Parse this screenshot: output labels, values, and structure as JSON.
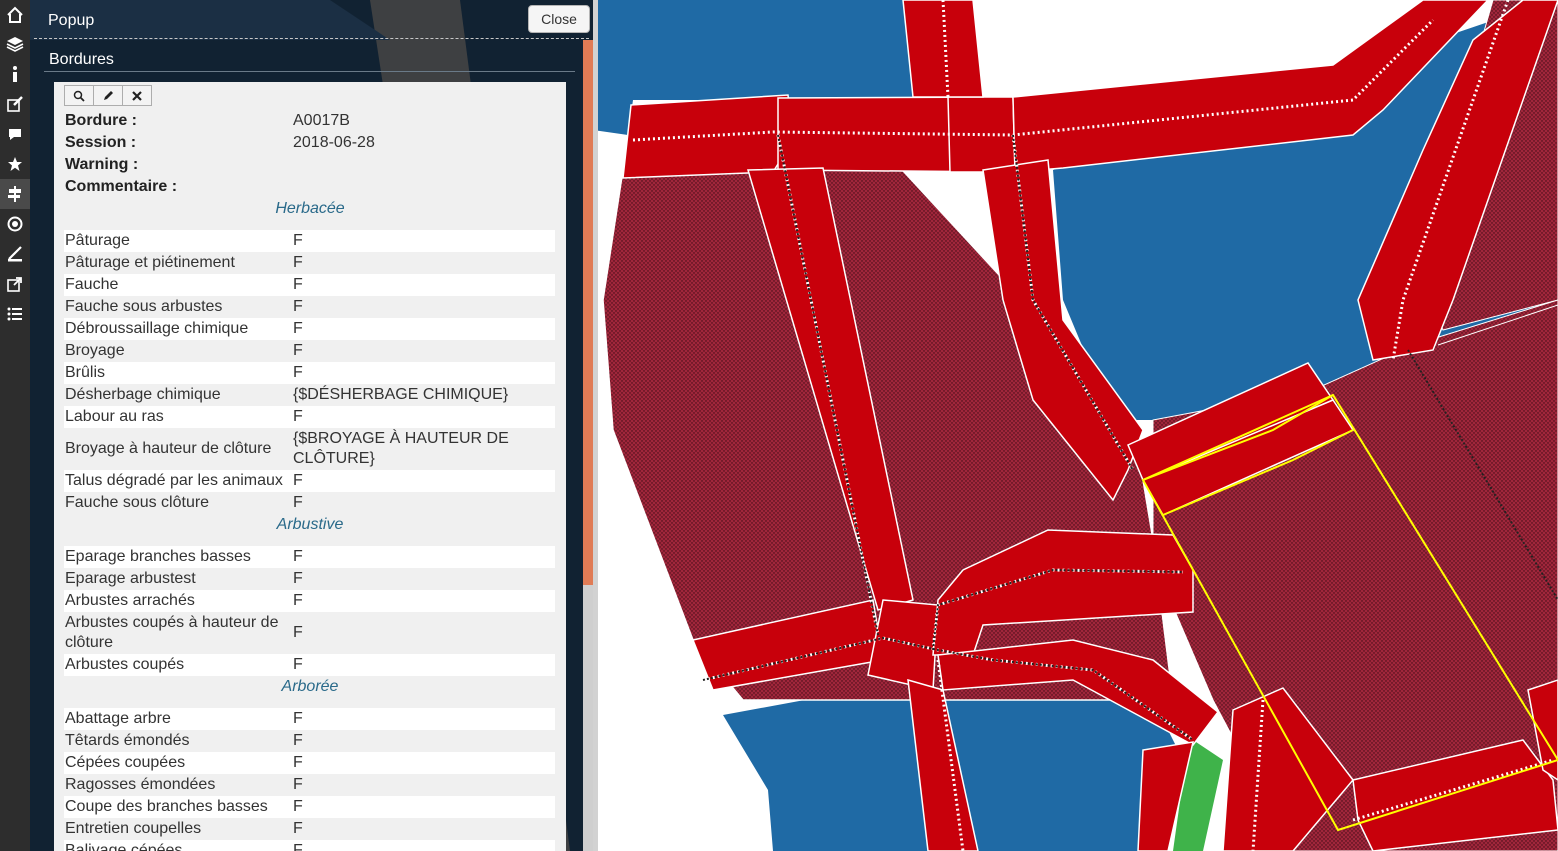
{
  "popup": {
    "title": "Popup",
    "close_label": "Close",
    "layer_title": "Bordures"
  },
  "toolbar": {
    "icons": [
      "home-icon",
      "layers-icon",
      "info-icon",
      "edit-icon",
      "comment-icon",
      "star-icon",
      "signpost-icon",
      "locate-icon",
      "measure-icon",
      "share-icon",
      "list-icon"
    ],
    "active": "signpost-icon"
  },
  "feature": {
    "fields": [
      {
        "label": "Bordure :",
        "value": "A0017B"
      },
      {
        "label": "Session :",
        "value": "2018-06-28"
      },
      {
        "label": "Warning :",
        "value": ""
      },
      {
        "label": "Commentaire :",
        "value": ""
      }
    ],
    "sections": [
      {
        "title": "Herbacée",
        "rows": [
          {
            "label": "Pâturage",
            "value": "F"
          },
          {
            "label": "Pâturage et piétinement",
            "value": "F"
          },
          {
            "label": "Fauche",
            "value": "F"
          },
          {
            "label": "Fauche sous arbustes",
            "value": "F"
          },
          {
            "label": "Débroussaillage chimique",
            "value": "F"
          },
          {
            "label": "Broyage",
            "value": "F"
          },
          {
            "label": "Brûlis",
            "value": "F"
          },
          {
            "label": "Désherbage chimique",
            "value": "{$DÉSHERBAGE CHIMIQUE}"
          },
          {
            "label": "Labour au ras",
            "value": "F"
          },
          {
            "label": "Broyage à hauteur de clôture",
            "value": "{$BROYAGE À HAUTEUR DE CLÔTURE}"
          },
          {
            "label": "Talus dégradé par les animaux",
            "value": "F"
          },
          {
            "label": "Fauche sous clôture",
            "value": "F"
          }
        ]
      },
      {
        "title": "Arbustive",
        "rows": [
          {
            "label": "Eparage branches basses",
            "value": "F"
          },
          {
            "label": "Eparage arbustest",
            "value": "F"
          },
          {
            "label": "Arbustes arrachés",
            "value": "F"
          },
          {
            "label": "Arbustes coupés à hauteur de clôture",
            "value": "F"
          },
          {
            "label": "Arbustes coupés",
            "value": "F"
          }
        ]
      },
      {
        "title": "Arborée",
        "rows": [
          {
            "label": "Abattage arbre",
            "value": "F"
          },
          {
            "label": "Têtards émondés",
            "value": "F"
          },
          {
            "label": "Cépées coupées",
            "value": "F"
          },
          {
            "label": "Ragosses émondées",
            "value": "F"
          },
          {
            "label": "Coupe des branches basses",
            "value": "F"
          },
          {
            "label": "Entretien coupelles",
            "value": "F"
          },
          {
            "label": "Balivage cépées",
            "value": "F"
          }
        ]
      }
    ]
  },
  "colors": {
    "panel": "#112232",
    "water": "#1f6aa5",
    "parcel": "#a0263b",
    "border_band": "#c8000b",
    "green": "#3fb34a",
    "highlight": "#ffff00"
  }
}
